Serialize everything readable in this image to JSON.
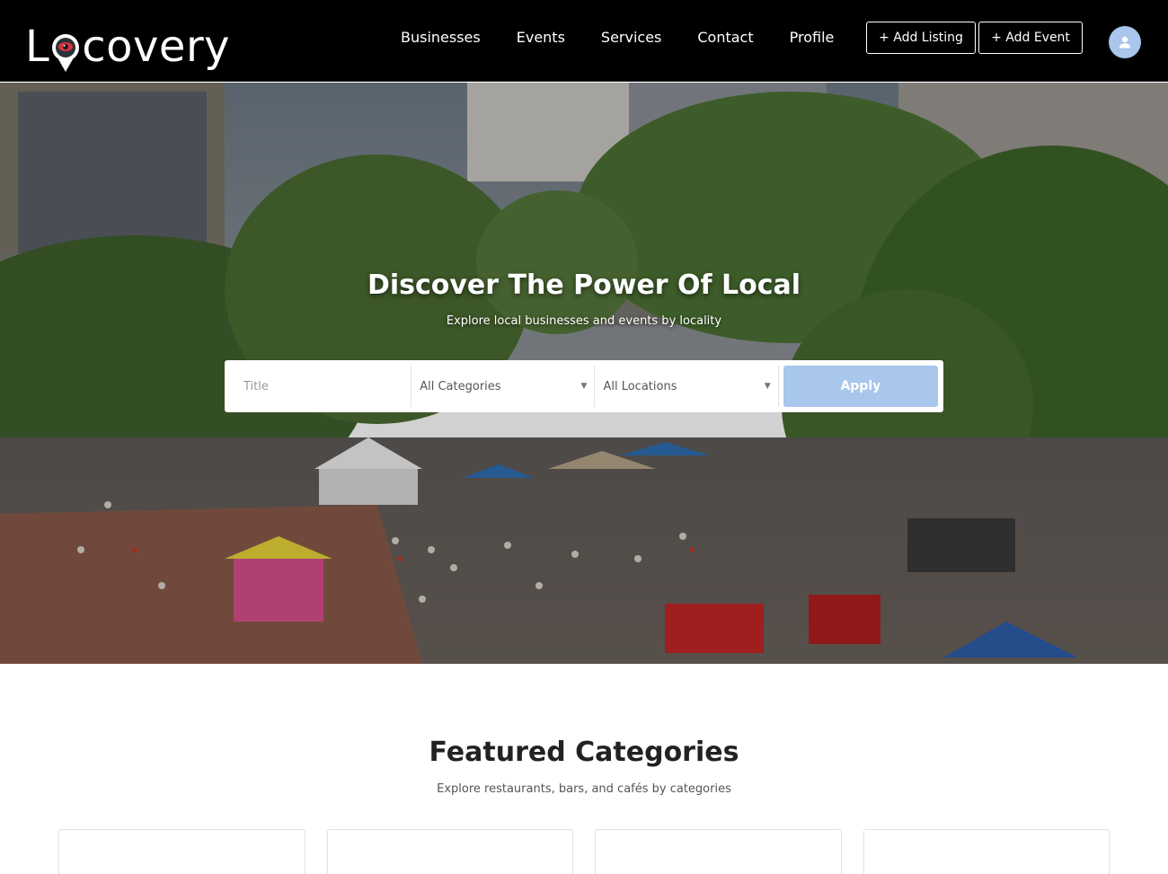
{
  "header": {
    "logo_text": "Locovery",
    "nav": [
      "Businesses",
      "Events",
      "Services",
      "Contact",
      "Profile"
    ],
    "add_listing_label": "+ Add Listing",
    "add_event_label": "+ Add Event",
    "avatar_icon": "user-icon"
  },
  "hero": {
    "title": "Discover The Power Of Local",
    "subtitle": "Explore local businesses and events by locality",
    "search": {
      "title_placeholder": "Title",
      "category_selected": "All Categories",
      "location_selected": "All Locations",
      "apply_label": "Apply"
    }
  },
  "featured": {
    "title": "Featured Categories",
    "subtitle": "Explore restaurants, bars, and cafés by categories"
  },
  "colors": {
    "header_bg": "#000000",
    "accent": "#a9c6ec",
    "logo_pin_red": "#d8333d"
  }
}
